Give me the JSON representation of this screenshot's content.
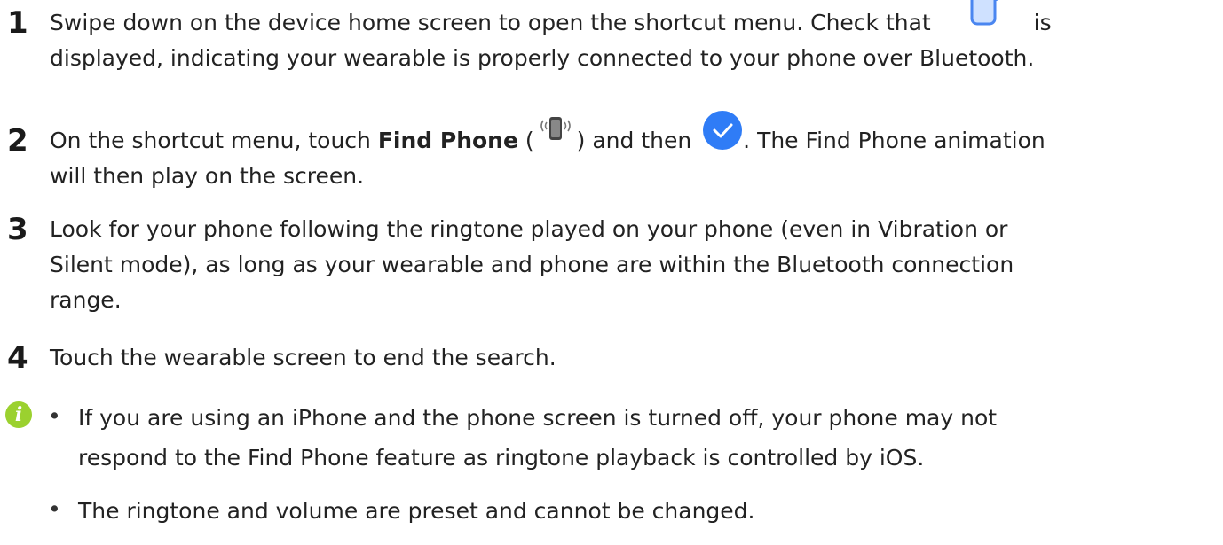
{
  "steps": [
    {
      "number": "1",
      "line1_a": "Swipe down on the device home screen to open the shortcut menu. Check that",
      "line1_b": "is",
      "line2": "displayed, indicating your wearable is properly connected to your phone over Bluetooth."
    },
    {
      "number": "2",
      "line1_a": "On the shortcut menu, touch",
      "bold": "Find Phone",
      "line1_b": "(",
      "line1_c": ") and then",
      "line1_d": ". The Find Phone animation",
      "line2": "will then play on the screen."
    },
    {
      "number": "3",
      "line1": "Look for your phone following the ringtone played on your phone (even in Vibration or",
      "line2": "Silent mode), as long as your wearable and phone are within the Bluetooth connection",
      "line3": "range."
    },
    {
      "number": "4",
      "line1": "Touch the wearable screen to end the search."
    }
  ],
  "note": {
    "icon": "info-icon",
    "bullets": [
      {
        "line1": "If you are using an iPhone and the phone screen is turned off, your phone may not",
        "line2": "respond to the Find Phone feature as ringtone playback is controlled by iOS."
      },
      {
        "line1": "The ringtone and volume are preset and cannot be changed."
      }
    ],
    "bullet_char": "•",
    "icon_char": "i"
  },
  "colors": {
    "text": "#222222",
    "phone_icon": "#5b8def",
    "check_icon": "#2f7cf6",
    "note_icon": "#9bd12f"
  }
}
